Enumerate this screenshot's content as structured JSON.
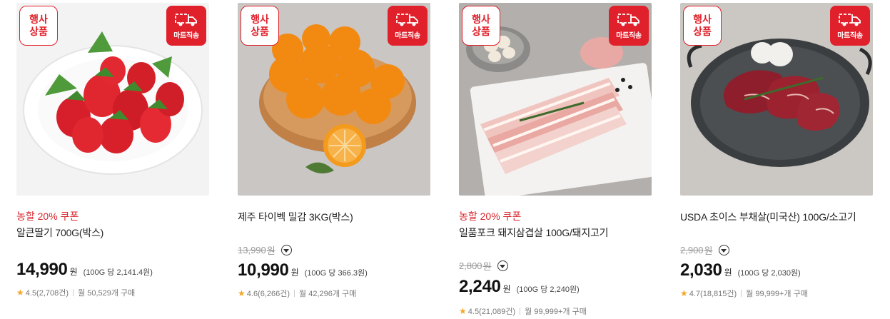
{
  "badges": {
    "event_line1": "행사",
    "event_line2": "상품",
    "ship": "마트직송"
  },
  "currency": "원",
  "products": [
    {
      "promo": "농할 20% 쿠폰",
      "name": "알큰딸기 700G(박스)",
      "original_price": "",
      "price": "14,990",
      "unit_price": "(100G 당 2,141.4원)",
      "rating": "4.5(2,708건)",
      "sales": "월 50,529개 구매"
    },
    {
      "promo": "",
      "name": "제주 타이벡 밀감 3KG(박스)",
      "original_price": "13,990",
      "price": "10,990",
      "unit_price": "(100G 당 366.3원)",
      "rating": "4.6(6,266건)",
      "sales": "월 42,296개 구매"
    },
    {
      "promo": "농할 20% 쿠폰",
      "name": "일품포크 돼지삼겹살 100G/돼지고기",
      "original_price": "2,800",
      "price": "2,240",
      "unit_price": "(100G 당 2,240원)",
      "rating": "4.5(21,089건)",
      "sales": "월 99,999+개 구매"
    },
    {
      "promo": "",
      "name": "USDA 초이스 부채살(미국산) 100G/소고기",
      "original_price": "2,900",
      "price": "2,030",
      "unit_price": "(100G 당 2,030원)",
      "rating": "4.7(18,815건)",
      "sales": "월 99,999+개 구매"
    }
  ],
  "colors": {
    "accent_red": "#e0202a",
    "promo_red": "#d8262c",
    "star": "#f5a623"
  }
}
